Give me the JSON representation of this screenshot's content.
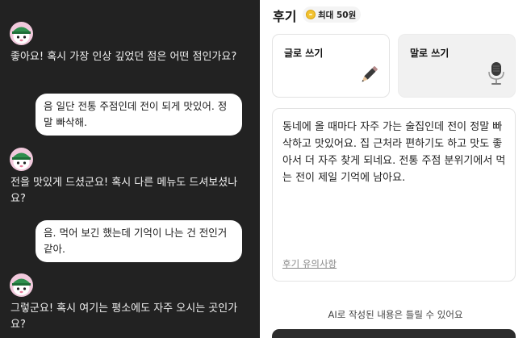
{
  "chat": {
    "messages": [
      {
        "from": "bot",
        "text": "좋아요! 혹시 가장 인상 깊었던 점은 어떤 점인가요?"
      },
      {
        "from": "user",
        "text": "음 일단 전통 주점인데 전이 되게 맛있어. 정말 빠삭해."
      },
      {
        "from": "bot",
        "text": "전을 맛있게 드셨군요! 혹시 다른 메뉴도 드셔보셨나요?"
      },
      {
        "from": "user",
        "text": "음. 먹어 보긴 했는데 기억이 나는 건 전인거 같아."
      },
      {
        "from": "bot",
        "text": "그렇군요! 혹시 여기는 평소에도 자주 오시는 곳인가요?"
      }
    ]
  },
  "review": {
    "title": "후기",
    "badge": "최대 50원",
    "mode_write": "글로 쓰기",
    "mode_voice": "말로 쓰기",
    "text": "동네에 올 때마다 자주 가는 술집인데 전이 정말 빠삭하고 맛있어요. 집 근처라 편하기도 하고 맛도 좋아서 더 자주 찾게 되네요. 전통 주점 분위기에서 먹는 전이 제일 기억에 남아요.",
    "notice_link": "후기 유의사항",
    "ai_note": "AI로 작성된 내용은 틀릴 수 있어요"
  },
  "colors": {
    "chat_bg": "#222222",
    "avatar_bg": "#f1c9dc",
    "avatar_hat": "#2f8f4e",
    "coin": "#f2c230",
    "submit_bg": "#2c2c2c"
  },
  "icons": {
    "avatar": "character-avatar-icon",
    "coin": "coin-icon",
    "pencil": "pencil-icon",
    "mic": "microphone-icon"
  }
}
